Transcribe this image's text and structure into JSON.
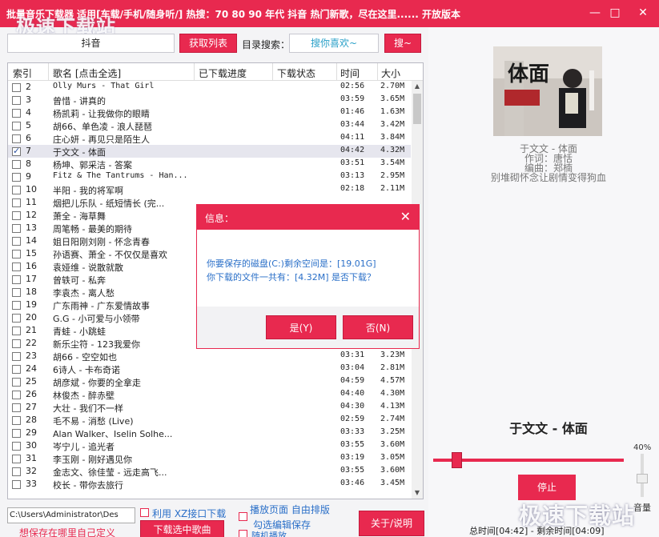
{
  "app": {
    "title": "批量音乐下载器  适用[车载/手机/随身听/] 热搜：70 80 90 年代 抖音 热门新歌，尽在这里...... 开放版本",
    "watermark": "极速下载站"
  },
  "window_buttons": {
    "minimize": "—",
    "maximize": "□",
    "close": "✕"
  },
  "search": {
    "value": "抖音",
    "button": "获取列表",
    "dir_label": "目录搜索：",
    "guess": "搜你喜欢~",
    "search_button": "搜~"
  },
  "table": {
    "headers": [
      "索引",
      "歌名 [点击全选]",
      "已下载进度",
      "下载状态",
      "时间",
      "大小"
    ],
    "rows": [
      {
        "checked": false,
        "index": "2",
        "name": "Olly Murs - That Girl",
        "time": "02:56",
        "size": "2.70M"
      },
      {
        "checked": false,
        "index": "3",
        "name": "曾惜 - 讲真的",
        "time": "03:59",
        "size": "3.65M"
      },
      {
        "checked": false,
        "index": "4",
        "name": "杨凯莉 - 让我做你的眼睛",
        "time": "01:46",
        "size": "1.63M"
      },
      {
        "checked": false,
        "index": "5",
        "name": "胡66、单色凌 - 浪人琵琶",
        "time": "03:44",
        "size": "3.42M"
      },
      {
        "checked": false,
        "index": "6",
        "name": "庄心妍 - 再见只是陌生人",
        "time": "04:11",
        "size": "3.84M"
      },
      {
        "checked": true,
        "index": "7",
        "name": "于文文 - 体面",
        "time": "04:42",
        "size": "4.32M"
      },
      {
        "checked": false,
        "index": "8",
        "name": "杨坤、郭采洁 - 答案",
        "time": "03:51",
        "size": "3.54M"
      },
      {
        "checked": false,
        "index": "9",
        "name": "Fitz & The Tantrums - Han...",
        "time": "03:13",
        "size": "2.95M"
      },
      {
        "checked": false,
        "index": "10",
        "name": "半阳 - 我的将军啊",
        "time": "02:18",
        "size": "2.11M"
      },
      {
        "checked": false,
        "index": "11",
        "name": "烟把儿乐队 - 纸短情长 (完...",
        "time": "",
        "size": ""
      },
      {
        "checked": false,
        "index": "12",
        "name": "萧全 - 海草舞",
        "time": "",
        "size": ""
      },
      {
        "checked": false,
        "index": "13",
        "name": "周笔畅 - 最美的期待",
        "time": "",
        "size": ""
      },
      {
        "checked": false,
        "index": "14",
        "name": "姐日阳刚刘刚 - 怀念青春",
        "time": "",
        "size": ""
      },
      {
        "checked": false,
        "index": "15",
        "name": "孙语赛、萧全 - 不仅仅是喜欢",
        "time": "",
        "size": ""
      },
      {
        "checked": false,
        "index": "16",
        "name": "袁娅维 - 说散就散",
        "time": "",
        "size": ""
      },
      {
        "checked": false,
        "index": "17",
        "name": "曾轶可 - 私奔",
        "time": "",
        "size": ""
      },
      {
        "checked": false,
        "index": "18",
        "name": "李袁杰 - 离人愁",
        "time": "",
        "size": ""
      },
      {
        "checked": false,
        "index": "19",
        "name": "广东雨神 - 广东爱情故事",
        "time": "",
        "size": ""
      },
      {
        "checked": false,
        "index": "20",
        "name": "G.G - 小可爱与小领带",
        "time": "",
        "size": ""
      },
      {
        "checked": false,
        "index": "21",
        "name": "青蛙 - 小跳蛙",
        "time": "",
        "size": ""
      },
      {
        "checked": false,
        "index": "22",
        "name": "新乐尘符 - 123我爱你",
        "time": "",
        "size": ""
      },
      {
        "checked": false,
        "index": "23",
        "name": "胡66 - 空空如也",
        "time": "03:31",
        "size": "3.23M"
      },
      {
        "checked": false,
        "index": "24",
        "name": "6诗人 - 卡布奇诺",
        "time": "03:04",
        "size": "2.81M"
      },
      {
        "checked": false,
        "index": "25",
        "name": "胡彦斌 - 你要的全拿走",
        "time": "04:59",
        "size": "4.57M"
      },
      {
        "checked": false,
        "index": "26",
        "name": "林俊杰 - 醉赤壁",
        "time": "04:40",
        "size": "4.30M"
      },
      {
        "checked": false,
        "index": "27",
        "name": "大壮 - 我们不一样",
        "time": "04:30",
        "size": "4.13M"
      },
      {
        "checked": false,
        "index": "28",
        "name": "毛不易 - 消愁 (Live)",
        "time": "02:59",
        "size": "2.74M"
      },
      {
        "checked": false,
        "index": "29",
        "name": "Alan Walker、Iselin Solhe...",
        "time": "03:33",
        "size": "3.25M"
      },
      {
        "checked": false,
        "index": "30",
        "name": "岑宁儿 - 追光者",
        "time": "03:55",
        "size": "3.60M"
      },
      {
        "checked": false,
        "index": "31",
        "name": "李玉刚 - 刚好遇见你",
        "time": "03:19",
        "size": "3.05M"
      },
      {
        "checked": false,
        "index": "32",
        "name": "金志文、徐佳莹 - 远走高飞...",
        "time": "03:55",
        "size": "3.60M"
      },
      {
        "checked": false,
        "index": "33",
        "name": "校长 - 带你去旅行",
        "time": "03:46",
        "size": "3.45M"
      }
    ]
  },
  "bottom": {
    "path": "C:\\Users\\Administrator\\Des",
    "hint": "想保存在哪里自己定义",
    "opt_xz": "利用 XZ接口下载",
    "play_text": "播放页面 自由排版",
    "opt_edit": "勾选编辑保存",
    "download": "下载选中歌曲",
    "about": "关于/说明",
    "random": "随机播放"
  },
  "player": {
    "cover_text": "体面",
    "song": "于文文 - 体面",
    "lyricist": "作词：唐恬",
    "composer": "编曲：郑楠",
    "lyric": "别堆砌怀念让剧情变得狗血",
    "now_playing": "于文文 - 体面",
    "volume_top": "40%",
    "stop": "停止",
    "volume_label": "音量",
    "total_time": "总时间[04:42] - 剩余时间[04:09]"
  },
  "dialog": {
    "title": "信息：",
    "line1": "你要保存的磁盘(C:)剩余空间是：[19.01G]",
    "line2": "你下载的文件一共有：[4.32M] 是否下载？",
    "yes": "是(Y)",
    "no": "否(N)"
  },
  "colors": {
    "accent": "#e8294f",
    "link": "#2a6fc8"
  }
}
